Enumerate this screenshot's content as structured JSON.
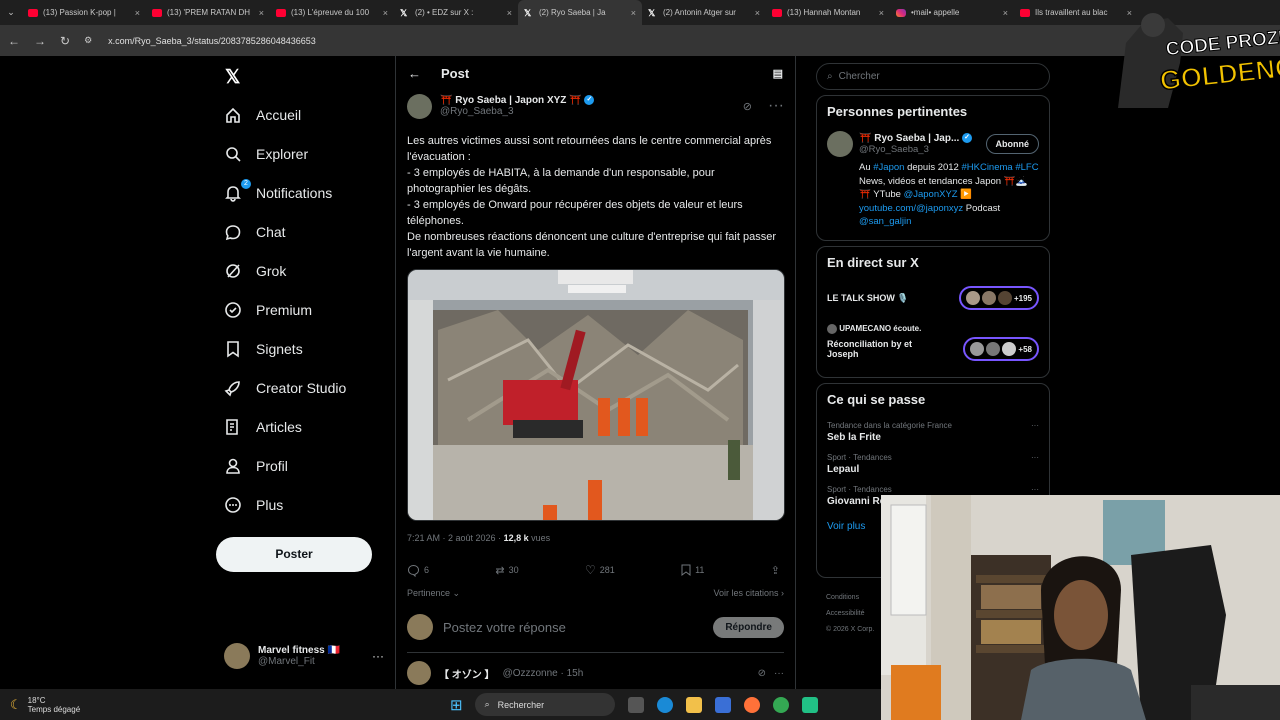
{
  "tabs": [
    {
      "title": "(13) Passion K-pop |",
      "icon": "youtube-icon"
    },
    {
      "title": "(13) 'PREM RATAN DH",
      "icon": "youtube-icon"
    },
    {
      "title": "(13) L'épreuve du 100",
      "icon": "youtube-icon"
    },
    {
      "title": "(2) • EDZ sur X :",
      "icon": "x-icon"
    },
    {
      "title": "(2) Ryo Saeba | Ja",
      "icon": "x-icon"
    },
    {
      "title": "(2) Antonin Atger sur",
      "icon": "x-icon"
    },
    {
      "title": "(13) Hannah Montan",
      "icon": "youtube-icon"
    },
    {
      "title": "•mail• appelle",
      "icon": "instagram-icon"
    },
    {
      "title": "Ils travaillent au blac",
      "icon": "youtube-icon"
    }
  ],
  "address": {
    "url": "x.com/Ryo_Saeba_3/status/2083785286048436653"
  },
  "sidebar": {
    "items": [
      {
        "label": "Accueil",
        "icon": "home-icon"
      },
      {
        "label": "Explorer",
        "icon": "search-icon"
      },
      {
        "label": "Notifications",
        "icon": "bell-icon",
        "badge": "2"
      },
      {
        "label": "Chat",
        "icon": "chat-icon"
      },
      {
        "label": "Grok",
        "icon": "grok-icon"
      },
      {
        "label": "Premium",
        "icon": "premium-icon"
      },
      {
        "label": "Signets",
        "icon": "bookmark-icon"
      },
      {
        "label": "Creator Studio",
        "icon": "rocket-icon"
      },
      {
        "label": "Articles",
        "icon": "article-icon"
      },
      {
        "label": "Profil",
        "icon": "person-icon"
      },
      {
        "label": "Plus",
        "icon": "more-icon"
      }
    ],
    "post_button": "Poster",
    "account": {
      "name": "Marvel fitness 🇫🇷",
      "handle": "@Marvel_Fit"
    }
  },
  "main": {
    "header": "Post",
    "tweet": {
      "author": "⛩️ Ryo Saeba | Japon XYZ ⛩️",
      "handle": "@Ryo_Saeba_3",
      "lines": [
        "Les autres victimes aussi sont retournées dans le centre commercial après l'évacuation :",
        "- 3 employés de HABITA, à la demande d'un responsable, pour photographier les dégâts.",
        "- 3 employés de Onward pour récupérer des objets de valeur et leurs téléphones.",
        "De nombreuses réactions dénoncent une culture d'entreprise qui fait passer l'argent avant la vie humaine."
      ],
      "time": "7:21 AM · 2 août 2026 · ",
      "views_count": "12,8 k",
      "views_label": " vues",
      "replies": "6",
      "retweets": "30",
      "likes": "281",
      "bookmarks": "11",
      "relevance": "Pertinence",
      "quotes": "Voir les citations"
    },
    "reply_placeholder": "Postez votre réponse",
    "reply_button": "Répondre",
    "next_reply": {
      "name": "【 オゾン 】",
      "handle": "@Ozzzonne · 15h"
    }
  },
  "right": {
    "search_placeholder": "Chercher",
    "relevant": {
      "title": "Personnes pertinentes",
      "name": "⛩️ Ryo Saeba | Jap...",
      "handle": "@Ryo_Saeba_3",
      "follow_label": "Abonné",
      "bio_parts": [
        {
          "t": "Au ",
          "link": false
        },
        {
          "t": "#Japon",
          "link": true
        },
        {
          "t": " depuis 2012 ",
          "link": false
        },
        {
          "t": "#HKCinema #LFC",
          "link": true
        },
        {
          "t": " News, vidéos et tendances Japon ⛩️🗻⛩️ YTube ",
          "link": false
        },
        {
          "t": "@JaponXYZ",
          "link": true
        },
        {
          "t": " ▶️ ",
          "link": false
        },
        {
          "t": "youtube.com/@japonxyz",
          "link": true
        },
        {
          "t": " Podcast ",
          "link": false
        },
        {
          "t": "@san_galjin",
          "link": true
        }
      ]
    },
    "live": {
      "title": "En direct sur X",
      "items": [
        {
          "host": "",
          "title": "LE TALK SHOW 🎙️",
          "count": "+195"
        },
        {
          "host": "UPAMECANO écoute.",
          "title": "Réconciliation by et Joseph",
          "count": "+58"
        }
      ]
    },
    "trends": {
      "title": "Ce qui se passe",
      "items": [
        {
          "meta": "Tendance dans la catégorie France",
          "name": "Seb la Frite"
        },
        {
          "meta": "Sport · Tendances",
          "name": "Lepaul"
        },
        {
          "meta": "Sport · Tendances",
          "name": "Giovanni Re"
        }
      ],
      "more": "Voir plus"
    },
    "footer": [
      "Conditions",
      "Accessibilité",
      "© 2026 X Corp."
    ]
  },
  "overlay_logo": {
    "line1": "CODE PROZIS",
    "line2": "GOLDENG"
  },
  "taskbar": {
    "temp": "18°C",
    "weather": "Temps dégagé",
    "search": "Rechercher"
  },
  "colors": {
    "accent": "#1d9bf0",
    "live": "#7856ff",
    "bg": "#000000"
  }
}
